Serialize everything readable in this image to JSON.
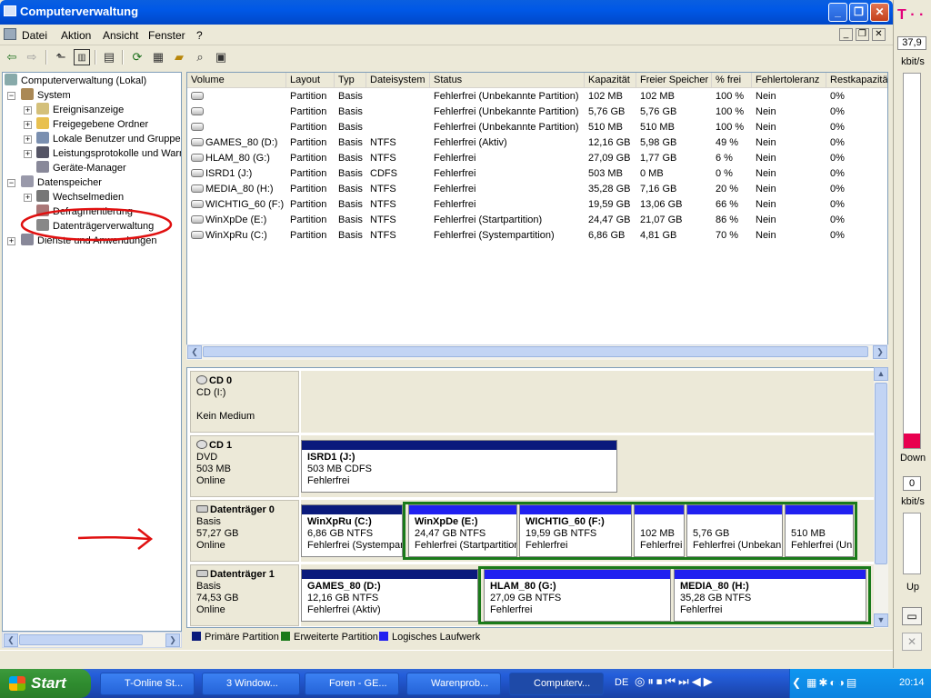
{
  "window": {
    "title": "Computerverwaltung",
    "min": "_",
    "max": "❐",
    "close": "✕"
  },
  "menu": [
    "Datei",
    "Aktion",
    "Ansicht",
    "Fenster",
    "?"
  ],
  "tree": {
    "root": "Computerverwaltung (Lokal)",
    "system": "System",
    "system_items": [
      "Ereignisanzeige",
      "Freigegebene Ordner",
      "Lokale Benutzer und Gruppen",
      "Leistungsprotokolle und Warnungen",
      "Geräte-Manager"
    ],
    "storage": "Datenspeicher",
    "storage_items": [
      "Wechselmedien",
      "Defragmentierung",
      "Datenträgerverwaltung"
    ],
    "services": "Dienste und Anwendungen"
  },
  "columns": [
    "Volume",
    "Layout",
    "Typ",
    "Dateisystem",
    "Status",
    "Kapazität",
    "Freier Speicher",
    "% frei",
    "Fehlertoleranz",
    "Restkapazität"
  ],
  "rows": [
    [
      "",
      "Partition",
      "Basis",
      "",
      "Fehlerfrei (Unbekannte Partition)",
      "102 MB",
      "102 MB",
      "100 %",
      "Nein",
      "0%"
    ],
    [
      "",
      "Partition",
      "Basis",
      "",
      "Fehlerfrei (Unbekannte Partition)",
      "5,76 GB",
      "5,76 GB",
      "100 %",
      "Nein",
      "0%"
    ],
    [
      "",
      "Partition",
      "Basis",
      "",
      "Fehlerfrei (Unbekannte Partition)",
      "510 MB",
      "510 MB",
      "100 %",
      "Nein",
      "0%"
    ],
    [
      "GAMES_80 (D:)",
      "Partition",
      "Basis",
      "NTFS",
      "Fehlerfrei (Aktiv)",
      "12,16 GB",
      "5,98 GB",
      "49 %",
      "Nein",
      "0%"
    ],
    [
      "HLAM_80 (G:)",
      "Partition",
      "Basis",
      "NTFS",
      "Fehlerfrei",
      "27,09 GB",
      "1,77 GB",
      "6 %",
      "Nein",
      "0%"
    ],
    [
      "ISRD1 (J:)",
      "Partition",
      "Basis",
      "CDFS",
      "Fehlerfrei",
      "503 MB",
      "0 MB",
      "0 %",
      "Nein",
      "0%"
    ],
    [
      "MEDIA_80 (H:)",
      "Partition",
      "Basis",
      "NTFS",
      "Fehlerfrei",
      "35,28 GB",
      "7,16 GB",
      "20 %",
      "Nein",
      "0%"
    ],
    [
      "WICHTIG_60 (F:)",
      "Partition",
      "Basis",
      "NTFS",
      "Fehlerfrei",
      "19,59 GB",
      "13,06 GB",
      "66 %",
      "Nein",
      "0%"
    ],
    [
      "WinXpDe (E:)",
      "Partition",
      "Basis",
      "NTFS",
      "Fehlerfrei (Startpartition)",
      "24,47 GB",
      "21,07 GB",
      "86 %",
      "Nein",
      "0%"
    ],
    [
      "WinXpRu (C:)",
      "Partition",
      "Basis",
      "NTFS",
      "Fehlerfrei (Systempartition)",
      "6,86 GB",
      "4,81 GB",
      "70 %",
      "Nein",
      "0%"
    ]
  ],
  "disks": [
    {
      "name": "CD 0",
      "l1": "CD (I:)",
      "l2": "",
      "l3": "Kein Medium"
    },
    {
      "name": "CD 1",
      "l1": "DVD",
      "l2": "503 MB",
      "l3": "Online"
    },
    {
      "name": "Datenträger 0",
      "l1": "Basis",
      "l2": "57,27 GB",
      "l3": "Online"
    },
    {
      "name": "Datenträger 1",
      "l1": "Basis",
      "l2": "74,53 GB",
      "l3": "Online"
    }
  ],
  "cd1_parts": [
    {
      "n": "ISRD1  (J:)",
      "s": "503 MB CDFS",
      "st": "Fehlerfrei"
    }
  ],
  "d0_parts": [
    {
      "n": "WinXpRu  (C:)",
      "s": "6,86 GB NTFS",
      "st": "Fehlerfrei (Systempartition)"
    },
    {
      "n": "WinXpDe  (E:)",
      "s": "24,47 GB NTFS",
      "st": "Fehlerfrei (Startpartition)"
    },
    {
      "n": "WICHTIG_60  (F:)",
      "s": "19,59 GB NTFS",
      "st": "Fehlerfrei"
    },
    {
      "n": "",
      "s": "102 MB",
      "st": "Fehlerfrei (Unbekannte Partition)"
    },
    {
      "n": "",
      "s": "5,76 GB",
      "st": "Fehlerfrei (Unbekannte Partition)"
    },
    {
      "n": "",
      "s": "510 MB",
      "st": "Fehlerfrei (Unbekannte Partition)"
    }
  ],
  "d1_parts": [
    {
      "n": "GAMES_80  (D:)",
      "s": "12,16 GB NTFS",
      "st": "Fehlerfrei (Aktiv)"
    },
    {
      "n": "HLAM_80  (G:)",
      "s": "27,09 GB NTFS",
      "st": "Fehlerfrei"
    },
    {
      "n": "MEDIA_80  (H:)",
      "s": "35,28 GB NTFS",
      "st": "Fehlerfrei"
    }
  ],
  "legend": [
    "Primäre Partition",
    "Erweiterte Partition",
    "Logisches Laufwerk"
  ],
  "colors": {
    "primary": "#0a1a7c",
    "extended": "#1a7a1a",
    "logical": "#2020f0",
    "annotation": "#e01010"
  },
  "meter": {
    "logo": "T · ·",
    "down_val": "37,9",
    "down_unit": "kbit/s",
    "down": "Down",
    "up_val": "0",
    "up_unit": "kbit/s",
    "up": "Up",
    "download_level": 0.04
  },
  "taskbar": {
    "start": "Start",
    "tasks": [
      "T-Online St...",
      "3 Window...",
      "Foren - GE...",
      "Warenprob...",
      "Computerv..."
    ],
    "lang": "DE",
    "time": "20:14"
  }
}
